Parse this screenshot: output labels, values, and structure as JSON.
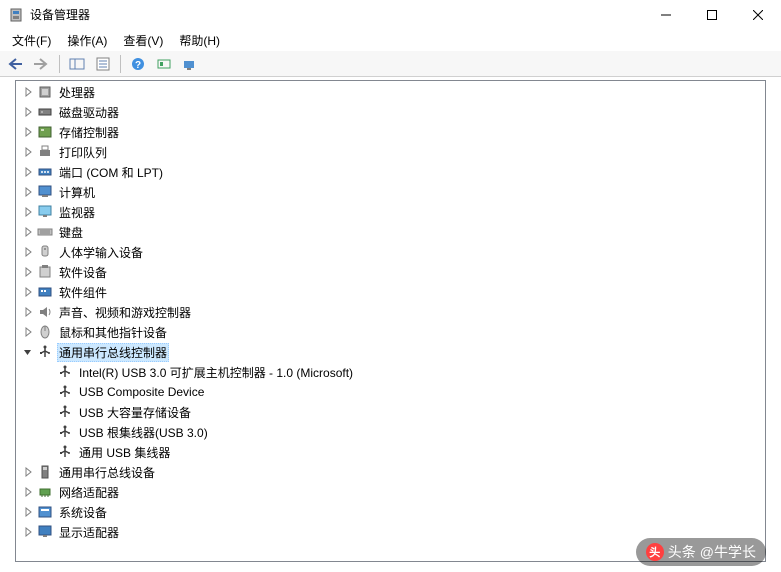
{
  "window": {
    "title": "设备管理器"
  },
  "menu": [
    {
      "label": "文件(F)"
    },
    {
      "label": "操作(A)"
    },
    {
      "label": "查看(V)"
    },
    {
      "label": "帮助(H)"
    }
  ],
  "toolbar_icons": [
    "back",
    "forward",
    "up-sep",
    "show-hide",
    "properties",
    "sep",
    "help",
    "update",
    "scan"
  ],
  "tree": {
    "categories": [
      {
        "name": "处理器",
        "icon": "cpu"
      },
      {
        "name": "磁盘驱动器",
        "icon": "disk"
      },
      {
        "name": "存储控制器",
        "icon": "storage"
      },
      {
        "name": "打印队列",
        "icon": "printer"
      },
      {
        "name": "端口 (COM 和 LPT)",
        "icon": "port"
      },
      {
        "name": "计算机",
        "icon": "computer"
      },
      {
        "name": "监视器",
        "icon": "monitor"
      },
      {
        "name": "键盘",
        "icon": "keyboard"
      },
      {
        "name": "人体学输入设备",
        "icon": "hid"
      },
      {
        "name": "软件设备",
        "icon": "software"
      },
      {
        "name": "软件组件",
        "icon": "component"
      },
      {
        "name": "声音、视频和游戏控制器",
        "icon": "audio"
      },
      {
        "name": "鼠标和其他指针设备",
        "icon": "mouse"
      },
      {
        "name": "通用串行总线控制器",
        "icon": "usb",
        "expanded": true,
        "selected": true,
        "children": [
          {
            "name": "Intel(R) USB 3.0 可扩展主机控制器 - 1.0 (Microsoft)",
            "icon": "usb"
          },
          {
            "name": "USB Composite Device",
            "icon": "usb"
          },
          {
            "name": "USB 大容量存储设备",
            "icon": "usb"
          },
          {
            "name": "USB 根集线器(USB 3.0)",
            "icon": "usb"
          },
          {
            "name": "通用 USB 集线器",
            "icon": "usb"
          }
        ]
      },
      {
        "name": "通用串行总线设备",
        "icon": "usb-device"
      },
      {
        "name": "网络适配器",
        "icon": "network"
      },
      {
        "name": "系统设备",
        "icon": "system"
      },
      {
        "name": "显示适配器",
        "icon": "display"
      }
    ]
  },
  "watermark": {
    "source": "头条",
    "author": "@牛学长"
  }
}
